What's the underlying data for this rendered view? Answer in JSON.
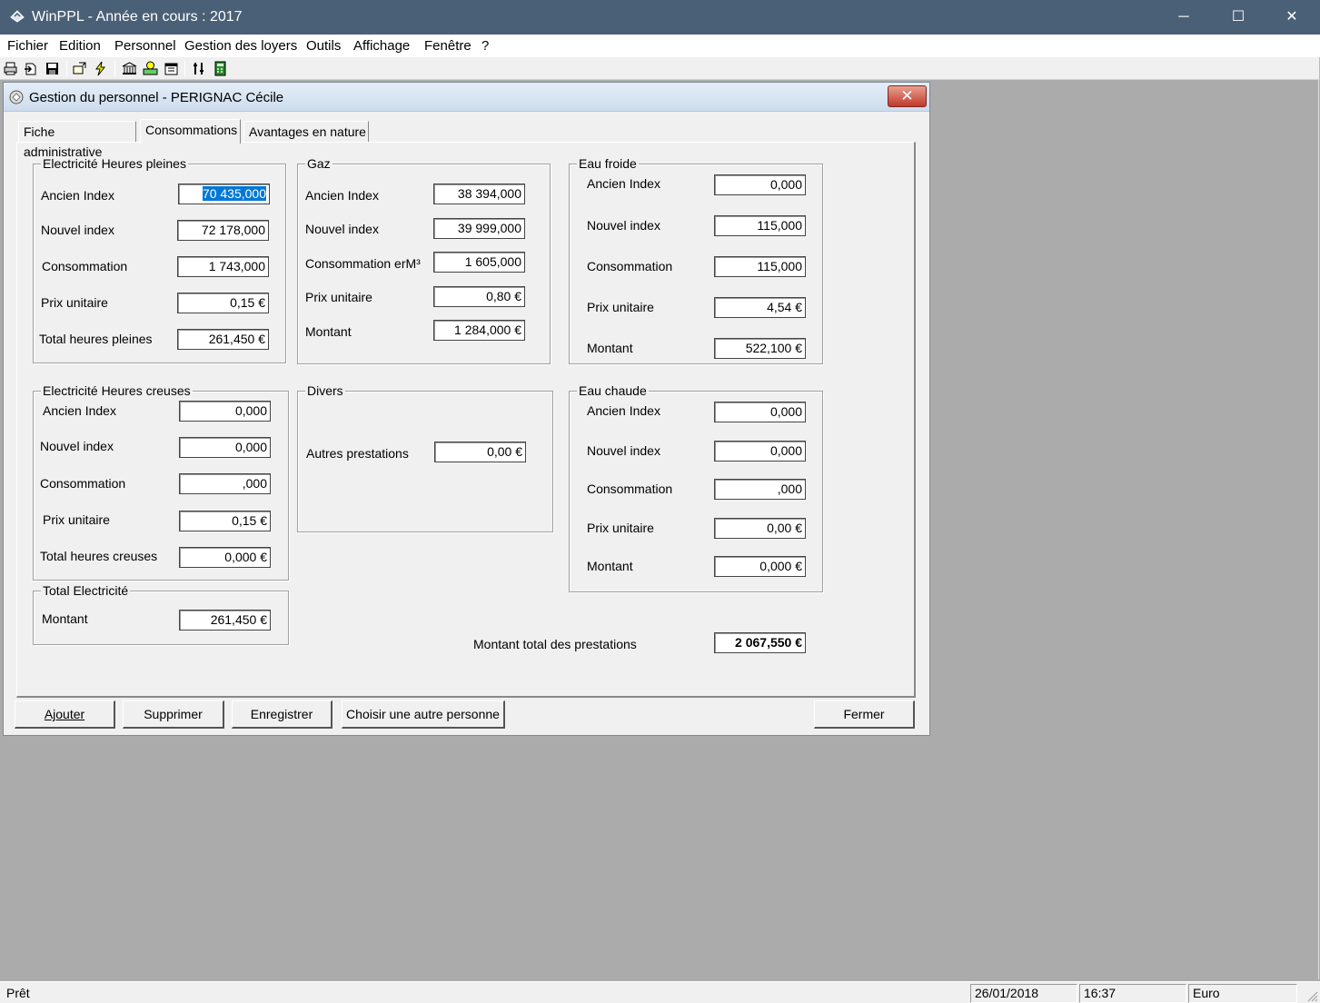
{
  "window": {
    "title": "WinPPL - Année en cours : 2017",
    "minimize": "─",
    "maximize": "☐",
    "close": "✕"
  },
  "menu": [
    "Fichier",
    "Edition",
    "Personnel",
    "Gestion des loyers",
    "Outils",
    "Affichage",
    "Fenêtre",
    "?"
  ],
  "toolbar_icons": [
    "print-icon",
    "print-preview-icon",
    "save-icon",
    "exchange-icon",
    "lightning-icon",
    "bank-icon",
    "cash-icon",
    "calendar-icon",
    "tools-icon",
    "calculator-icon"
  ],
  "dialog": {
    "title": "Gestion du personnel - PERIGNAC Cécile",
    "close": "✕",
    "tabs": [
      "Fiche administrative",
      "Consommations",
      "Avantages en nature"
    ],
    "active_tab": 1
  },
  "elec_hp": {
    "legend": "Electricité Heures pleines",
    "labels": [
      "Ancien Index",
      "Nouvel index",
      "Consommation",
      "Prix unitaire",
      "Total heures pleines"
    ],
    "values": [
      "70 435,000",
      "72 178,000",
      "1 743,000",
      "0,15 €",
      "261,450 €"
    ]
  },
  "gaz": {
    "legend": "Gaz",
    "labels": [
      "Ancien Index",
      "Nouvel index",
      "Consommation erM³",
      "Prix unitaire",
      "Montant"
    ],
    "values": [
      "38 394,000",
      "39 999,000",
      "1 605,000",
      "0,80 €",
      "1 284,000 €"
    ]
  },
  "eau_froide": {
    "legend": "Eau froide",
    "labels": [
      "Ancien Index",
      "Nouvel index",
      "Consommation",
      "Prix unitaire",
      "Montant"
    ],
    "values": [
      "0,000",
      "115,000",
      "115,000",
      "4,54 €",
      "522,100 €"
    ]
  },
  "elec_hc": {
    "legend": "Electricité Heures creuses",
    "labels": [
      "Ancien Index",
      "Nouvel index",
      "Consommation",
      "Prix unitaire",
      "Total heures creuses"
    ],
    "values": [
      "0,000",
      "0,000",
      ",000",
      "0,15 €",
      "0,000 €"
    ]
  },
  "divers": {
    "legend": "Divers",
    "label": "Autres prestations",
    "value": "0,00 €"
  },
  "eau_chaude": {
    "legend": "Eau chaude",
    "labels": [
      "Ancien Index",
      "Nouvel index",
      "Consommation",
      "Prix unitaire",
      "Montant"
    ],
    "values": [
      "0,000",
      "0,000",
      ",000",
      "0,00 €",
      "0,000 €"
    ]
  },
  "total_elec": {
    "legend": "Total Electricité",
    "label": "Montant",
    "value": "261,450 €"
  },
  "total": {
    "label": "Montant total des prestations",
    "value": "2 067,550 €"
  },
  "buttons": {
    "add": "Ajouter",
    "delete": "Supprimer",
    "save": "Enregistrer",
    "choose": "Choisir une autre personne",
    "close": "Fermer"
  },
  "status": {
    "text": "Prêt",
    "date": "26/01/2018",
    "time": "16:37",
    "currency": "Euro"
  }
}
